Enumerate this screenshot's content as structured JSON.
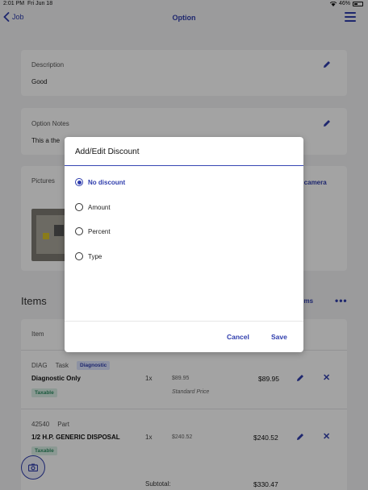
{
  "status_bar": {
    "time": "2:01 PM",
    "date": "Fri Jun 18",
    "battery": "46%"
  },
  "nav": {
    "back_label": "Job",
    "title": "Option"
  },
  "description": {
    "label": "Description",
    "value": "Good"
  },
  "option_notes": {
    "label": "Option Notes",
    "value": "This a the"
  },
  "pictures": {
    "label": "Pictures",
    "camera_link": "e camera"
  },
  "items_section": {
    "title": "Items",
    "link": "ems",
    "more": "•••",
    "column_header": "Item"
  },
  "items": [
    {
      "code": "DIAG",
      "type": "Task",
      "badge": "Diagnostic",
      "name": "Diagnostic Only",
      "tax": "Taxable",
      "qty": "1x",
      "unit_price": "$89.95",
      "price_note": "Standard Price",
      "total": "$89.95"
    },
    {
      "code": "42540",
      "type": "Part",
      "badge": "",
      "name": "1/2 H.P. GENERIC DISPOSAL",
      "tax": "Taxable",
      "qty": "1x",
      "unit_price": "$240.52",
      "price_note": "",
      "total": "$240.52"
    }
  ],
  "subtotal": {
    "label": "Subtotal:",
    "value": "$330.47"
  },
  "dialog": {
    "title": "Add/Edit Discount",
    "options": [
      "No discount",
      "Amount",
      "Percent",
      "Type"
    ],
    "selected_index": 0,
    "cancel_label": "Cancel",
    "save_label": "Save"
  },
  "colors": {
    "accent": "#2f3dad",
    "background": "#f2f2f4",
    "overlay": "rgba(0,0,0,0.36)"
  },
  "icons": [
    "wifi-icon",
    "battery-icon",
    "back-chevron-icon",
    "hamburger-menu-icon",
    "pencil-icon",
    "close-icon",
    "camera-icon"
  ]
}
